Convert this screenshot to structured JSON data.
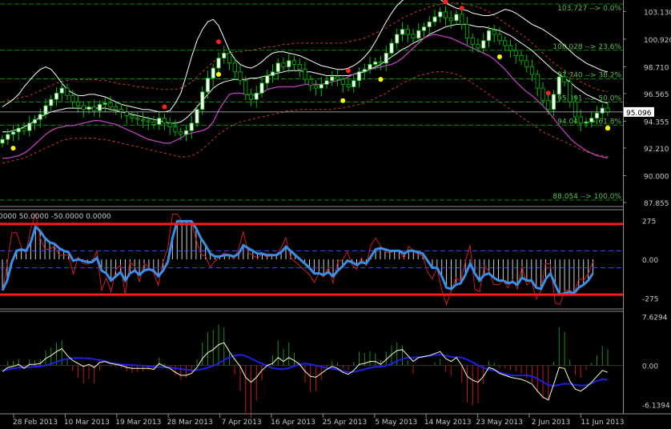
{
  "colors": {
    "background": "#000000",
    "bull_candle": "#ffffff",
    "bear_candle": "#000000",
    "candle_wick": "#00c000",
    "fib_line": "#009000",
    "fib_label": "#5fbf4f",
    "bb_outer": "#ffffff",
    "envelope": "#c83c32",
    "ma_magenta": "#c040c0",
    "fractal_up": "#ff2020",
    "fractal_down": "#ffff00",
    "cci_line": "#3a8ee6",
    "cci_fast": "#d21c1c",
    "cci_level": "#ff1a1a",
    "cci_dash": "#3050ff",
    "osc_up": "#1e8c1e",
    "osc_down": "#c01818",
    "osc_signal": "#2020e0",
    "osc_line": "#ffffc8",
    "axis_text": "#c8c8c8"
  },
  "chart_data": [
    {
      "type": "line",
      "panel": "price",
      "ylim": [
        87.855,
        103.727
      ],
      "y_ticks": [
        "103.130",
        "100.920",
        "98.710",
        "96.565",
        "94.355",
        "92.210",
        "90.000",
        "87.855"
      ],
      "current_price": "95.096",
      "fib_levels": [
        {
          "value": 103.727,
          "label": "103.727 --> 0.0%"
        },
        {
          "value": 100.028,
          "label": "100.028 --> 23.6%"
        },
        {
          "value": 97.74,
          "label": "97.740 --> 38.2%"
        },
        {
          "value": 95.891,
          "label": "95.891 --> 50.0%"
        },
        {
          "value": 94.042,
          "label": "94.042 --> 61.8%"
        },
        {
          "value": 88.054,
          "label": "88.054 --> 100.0%"
        }
      ],
      "x_labels": [
        "28 Feb 2013",
        "10 Mar 2013",
        "19 Mar 2013",
        "28 Mar 2013",
        "7 Apr 2013",
        "16 Apr 2013",
        "25 Apr 2013",
        "5 May 2013",
        "14 May 2013",
        "23 May 2013",
        "2 Jun 2013",
        "11 Jun 2013"
      ],
      "close": [
        92.9,
        93.3,
        93.5,
        93.8,
        93.6,
        94.2,
        94.5,
        94.9,
        95.6,
        96.1,
        96.6,
        97.0,
        96.4,
        95.9,
        95.6,
        95.3,
        95.5,
        95.2,
        95.7,
        95.8,
        95.5,
        95.3,
        95.1,
        94.8,
        94.6,
        94.5,
        94.4,
        94.3,
        94.1,
        94.6,
        94.2,
        93.9,
        93.5,
        93.3,
        93.6,
        94.2,
        95.3,
        96.7,
        97.8,
        98.6,
        99.4,
        99.8,
        99.0,
        98.3,
        97.6,
        96.5,
        96.1,
        96.6,
        97.4,
        98.0,
        98.3,
        99.0,
        98.7,
        99.2,
        98.9,
        98.5,
        97.7,
        97.2,
        97.0,
        97.3,
        97.6,
        97.9,
        97.7,
        97.3,
        97.1,
        97.6,
        98.3,
        98.5,
        98.9,
        99.1,
        99.0,
        99.8,
        100.6,
        101.3,
        101.7,
        101.3,
        101.0,
        101.6,
        101.9,
        102.3,
        102.7,
        103.1,
        102.6,
        102.4,
        102.9,
        102.1,
        101.0,
        100.5,
        100.2,
        100.8,
        101.6,
        101.3,
        100.8,
        100.4,
        100.0,
        99.6,
        99.2,
        98.7,
        98.1,
        97.0,
        96.0,
        95.3,
        96.5,
        97.9,
        97.5,
        95.9,
        94.7,
        94.2,
        94.3,
        94.6,
        95.0,
        95.4,
        95.1
      ],
      "bb_upper": [
        95.5,
        95.8,
        96.1,
        96.5,
        97.1,
        97.6,
        98.1,
        98.5,
        98.7,
        98.5,
        98.0,
        97.4,
        96.9,
        96.6,
        96.4,
        96.4,
        96.5,
        96.5,
        96.4,
        96.3,
        96.1,
        95.9,
        95.7,
        95.6,
        95.5,
        95.4,
        95.3,
        95.3,
        95.2,
        95.1,
        95.1,
        95.2,
        95.8,
        96.6,
        98.0,
        99.5,
        100.8,
        101.7,
        102.3,
        102.5,
        102.0,
        101.0,
        100.0,
        99.3,
        98.9,
        98.7,
        98.6,
        98.8,
        99.1,
        99.5,
        99.8,
        99.9,
        99.9,
        99.8,
        99.7,
        99.6,
        99.4,
        99.2,
        99.0,
        98.8,
        98.7,
        98.6,
        98.5,
        98.5,
        98.6,
        98.8,
        99.1,
        99.5,
        100.0,
        100.7,
        101.5,
        102.3,
        103.0,
        103.6,
        104.0,
        104.3,
        104.4,
        104.5,
        104.5,
        104.4,
        104.3,
        104.1,
        103.8,
        103.6,
        103.4,
        103.3,
        103.2,
        103.0,
        102.9,
        102.8,
        102.8,
        102.9,
        103.1,
        103.3,
        103.2,
        103.0,
        102.7,
        102.4,
        102.1,
        101.9,
        101.7,
        101.4,
        101.1,
        100.8,
        100.4,
        100.0,
        99.6,
        99.3,
        99.0,
        98.8,
        98.6,
        98.4,
        98.3
      ],
      "bb_middle": [
        93.5,
        93.5,
        93.6,
        93.7,
        93.9,
        94.1,
        94.4,
        94.7,
        94.9,
        95.1,
        95.2,
        95.3,
        95.4,
        95.4,
        95.4,
        95.4,
        95.4,
        95.4,
        95.4,
        95.4,
        95.3,
        95.2,
        95.1,
        95.0,
        94.9,
        94.8,
        94.7,
        94.6,
        94.5,
        94.4,
        94.3,
        94.2,
        94.2,
        94.3,
        94.6,
        95.0,
        95.5,
        96.0,
        96.5,
        97.0,
        97.3,
        97.5,
        97.6,
        97.7,
        97.7,
        97.7,
        97.8,
        97.8,
        97.9,
        98.0,
        98.1,
        98.2,
        98.3,
        98.4,
        98.4,
        98.4,
        98.3,
        98.3,
        98.2,
        98.1,
        98.0,
        98.0,
        98.0,
        98.0,
        98.0,
        98.1,
        98.2,
        98.3,
        98.5,
        98.7,
        98.9,
        99.2,
        99.5,
        99.8,
        100.1,
        100.3,
        100.6,
        100.8,
        101.0,
        101.3,
        101.5,
        101.7,
        101.9,
        102.0,
        102.1,
        102.1,
        102.1,
        102.0,
        101.9,
        101.9,
        101.8,
        101.7,
        101.6,
        101.4,
        101.2,
        100.9,
        100.6,
        100.3,
        100.0,
        99.6,
        99.2,
        98.8,
        98.4,
        98.1,
        97.8,
        97.5,
        97.1,
        96.8,
        96.5,
        96.3,
        96.1,
        95.9,
        95.8
      ],
      "envelope_upper": [
        95.9,
        96.0,
        96.1,
        96.2,
        96.3,
        96.4,
        96.6,
        96.8,
        97.0,
        97.2,
        97.4,
        97.5,
        97.6,
        97.7,
        97.7,
        97.7,
        97.7,
        97.7,
        97.6,
        97.6,
        97.5,
        97.4,
        97.3,
        97.3,
        97.2,
        97.1,
        97.1,
        97.0,
        97.0,
        96.9,
        96.9,
        96.9,
        96.9,
        97.0,
        97.2,
        97.5,
        97.9,
        98.3,
        98.7,
        99.1,
        99.4,
        99.6,
        99.8,
        99.9,
        99.9,
        100.0,
        100.0,
        100.1,
        100.2,
        100.3,
        100.3,
        100.4,
        100.5,
        100.5,
        100.6,
        100.6,
        100.6,
        100.6,
        100.6,
        100.6,
        100.6,
        100.6,
        100.6,
        100.6,
        100.7,
        100.8,
        100.9,
        101.0,
        101.2,
        101.4,
        101.6,
        101.8,
        102.1,
        102.3,
        102.6,
        102.8,
        103.0,
        103.2,
        103.3,
        103.5,
        103.6,
        103.7,
        103.8,
        103.8,
        103.8,
        103.8,
        103.7,
        103.6,
        103.5,
        103.3,
        103.1,
        102.8,
        102.5,
        102.2,
        101.9,
        101.6,
        101.3,
        101.0,
        100.6,
        100.2,
        99.8,
        99.4,
        99.0,
        98.7,
        98.4,
        98.1,
        97.8,
        97.5,
        97.3,
        97.1,
        96.9,
        96.8,
        96.7
      ],
      "envelope_lower": [
        91.0,
        91.1,
        91.2,
        91.3,
        91.4,
        91.6,
        91.8,
        92.0,
        92.2,
        92.4,
        92.6,
        92.8,
        92.9,
        93.0,
        93.0,
        93.0,
        93.0,
        93.0,
        92.9,
        92.9,
        92.8,
        92.7,
        92.6,
        92.5,
        92.4,
        92.3,
        92.2,
        92.1,
        92.0,
        91.9,
        91.8,
        91.7,
        91.6,
        91.5,
        91.5,
        91.6,
        91.8,
        92.1,
        92.5,
        92.9,
        93.3,
        93.6,
        93.9,
        94.1,
        94.3,
        94.4,
        94.5,
        94.6,
        94.7,
        94.8,
        94.9,
        95.0,
        95.1,
        95.2,
        95.2,
        95.3,
        95.3,
        95.3,
        95.3,
        95.3,
        95.3,
        95.3,
        95.4,
        95.4,
        95.5,
        95.6,
        95.7,
        95.8,
        96.0,
        96.2,
        96.4,
        96.6,
        96.9,
        97.1,
        97.4,
        97.6,
        97.8,
        98.0,
        98.1,
        98.2,
        98.3,
        98.3,
        98.3,
        98.2,
        98.1,
        97.9,
        97.7,
        97.4,
        97.1,
        96.8,
        96.5,
        96.2,
        95.9,
        95.6,
        95.3,
        95.0,
        94.7,
        94.4,
        94.1,
        93.8,
        93.5,
        93.3,
        93.1,
        92.9,
        92.7,
        92.5,
        92.3,
        92.1,
        91.9,
        91.8,
        91.7,
        91.6,
        91.5
      ],
      "magenta_ma": [
        91.4,
        91.4,
        91.5,
        91.6,
        91.8,
        92.1,
        92.5,
        92.9,
        93.3,
        93.6,
        93.8,
        93.9,
        94.0,
        94.0,
        94.1,
        94.2,
        94.3,
        94.4,
        94.4,
        94.3,
        94.2,
        94.1,
        93.9,
        93.7,
        93.5,
        93.3,
        93.1,
        92.9,
        92.8,
        92.7,
        92.6,
        92.6,
        92.8,
        93.0,
        93.3,
        93.4,
        93.5,
        93.6,
        93.8,
        94.3,
        95.2,
        95.9,
        96.5,
        96.6,
        96.6,
        96.5,
        96.4,
        96.5,
        96.6,
        96.9,
        97.0,
        97.1,
        97.1,
        97.1,
        97.1,
        97.2,
        97.3,
        97.3,
        97.3,
        97.3,
        97.4,
        97.5,
        97.6,
        97.7,
        97.9,
        98.1,
        98.3,
        98.4,
        98.5,
        98.6,
        98.7,
        98.8,
        98.9,
        99.1,
        99.4,
        99.8,
        100.2,
        100.6,
        101.0,
        101.2,
        101.3,
        101.2,
        101.1,
        101.0,
        100.8,
        100.6,
        100.4,
        100.2,
        100.0,
        99.8,
        99.6,
        99.3,
        98.9,
        98.5,
        98.0,
        97.5,
        97.1,
        96.7,
        96.4,
        96.0,
        95.6,
        95.1,
        94.6,
        94.0,
        93.5,
        93.0,
        92.6,
        92.3,
        92.0,
        91.8,
        91.6,
        91.5,
        91.4
      ],
      "fractals_up": [
        30,
        40,
        64,
        82,
        85,
        101
      ],
      "fractals_down": [
        2,
        40,
        63,
        70,
        92,
        114,
        139,
        140
      ]
    },
    {
      "type": "bar",
      "panel": "cci",
      "header": "0000 50.0000 -50.0000 0.0000",
      "ylim": [
        -340,
        340
      ],
      "y_ticks": [
        "275",
        "0.00",
        "-275"
      ],
      "levels": [
        250,
        -250
      ],
      "dashed_levels": [
        60,
        -60
      ],
      "cci": [
        -220,
        -150,
        -20,
        60,
        70,
        60,
        120,
        230,
        200,
        150,
        120,
        110,
        80,
        60,
        50,
        -10,
        0,
        -10,
        -20,
        -20,
        10,
        -80,
        -100,
        -150,
        -120,
        -90,
        -150,
        -100,
        -80,
        -110,
        -80,
        -70,
        -80,
        -120,
        -80,
        -20,
        150,
        270,
        270,
        270,
        270,
        220,
        150,
        100,
        40,
        20,
        20,
        30,
        30,
        20,
        40,
        100,
        80,
        60,
        40,
        40,
        30,
        30,
        30,
        50,
        90,
        60,
        30,
        0,
        -30,
        -60,
        -100,
        -100,
        -110,
        -90,
        -120,
        -80,
        -50,
        -10,
        -20,
        -40,
        -20,
        -30,
        20,
        70,
        80,
        70,
        60,
        60,
        60,
        40,
        60,
        60,
        50,
        40,
        -10,
        -60,
        -60,
        -120,
        -200,
        -210,
        -180,
        -170,
        -110,
        -30,
        -100,
        -150,
        -110,
        -100,
        -130,
        -150,
        -150,
        -170,
        -160,
        -180,
        -130,
        -150,
        -150,
        -200,
        -210,
        -140,
        -100,
        -180,
        -250,
        -240,
        -230,
        -240,
        -200,
        -180,
        -150,
        -100
      ]
    },
    {
      "type": "bar",
      "panel": "oscillator",
      "ylim": [
        -7.2,
        8.6
      ],
      "y_ticks": [
        "7.6294",
        "0.00",
        "-6.1394"
      ]
    }
  ]
}
